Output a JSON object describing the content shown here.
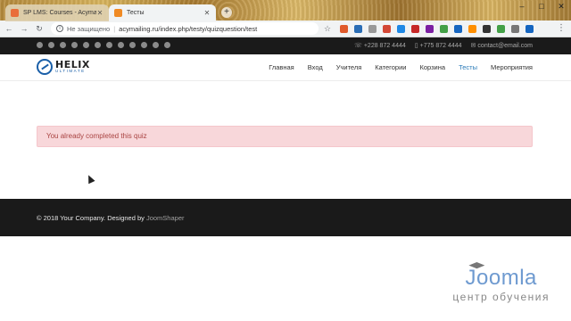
{
  "browser": {
    "tabs": [
      {
        "title": "SP LMS: Courses - Acymailing - ",
        "favicon_color": "#e96d3a",
        "active": false
      },
      {
        "title": "Тесты",
        "favicon_color": "#f08a24",
        "active": true
      }
    ],
    "new_tab_label": "+",
    "window_controls": [
      "–",
      "□",
      "✕"
    ],
    "nav": {
      "back": "←",
      "forward": "→",
      "reload": "↻"
    },
    "address": {
      "security_label": "Не защищено",
      "url": "acymailing.ru/index.php/testy/quizquestion/test"
    },
    "star": "☆",
    "extensions": [
      "#e05a2b",
      "#2a6db5",
      "#999999",
      "#d34836",
      "#1e88e5",
      "#c62828",
      "#7b1fa2",
      "#43a047",
      "#1565c0",
      "#ff8f00",
      "#333333",
      "#43a047",
      "#777777",
      "#1565c0"
    ],
    "menu": "⋮"
  },
  "topbar": {
    "social_icons": [
      "facebook-icon",
      "twitter-icon",
      "pinterest-icon",
      "youtube-icon",
      "linkedin-icon",
      "dribbble-icon",
      "instagram-icon",
      "behance-icon",
      "vk-icon",
      "flickr-icon",
      "skype-icon",
      "whatsapp-icon"
    ],
    "contacts": [
      {
        "icon": "☏",
        "text": "+228 872 4444"
      },
      {
        "icon": "▯",
        "text": "+775 872 4444"
      },
      {
        "icon": "✉",
        "text": "contact@email.com"
      }
    ]
  },
  "header": {
    "logo_title": "HELIX",
    "logo_subtitle": "ULTIMATE",
    "nav": [
      {
        "label": "Главная",
        "active": false
      },
      {
        "label": "Вход",
        "active": false
      },
      {
        "label": "Учителя",
        "active": false
      },
      {
        "label": "Категории",
        "active": false
      },
      {
        "label": "Корзина",
        "active": false
      },
      {
        "label": "Тесты",
        "active": true
      },
      {
        "label": "Мероприятия",
        "active": false
      }
    ]
  },
  "content": {
    "alert": "You already completed this quiz"
  },
  "footer": {
    "copyright": "© 2018 Your Company. Designed by ",
    "designer": "JoomShaper"
  },
  "watermark": {
    "logo": "Joomla",
    "subtitle": "центр обучения"
  },
  "colors": {
    "alert_bg": "#f8d7da",
    "alert_text": "#a94442",
    "nav_active": "#2a7ab8",
    "dark_bar": "#1a1a1a"
  }
}
